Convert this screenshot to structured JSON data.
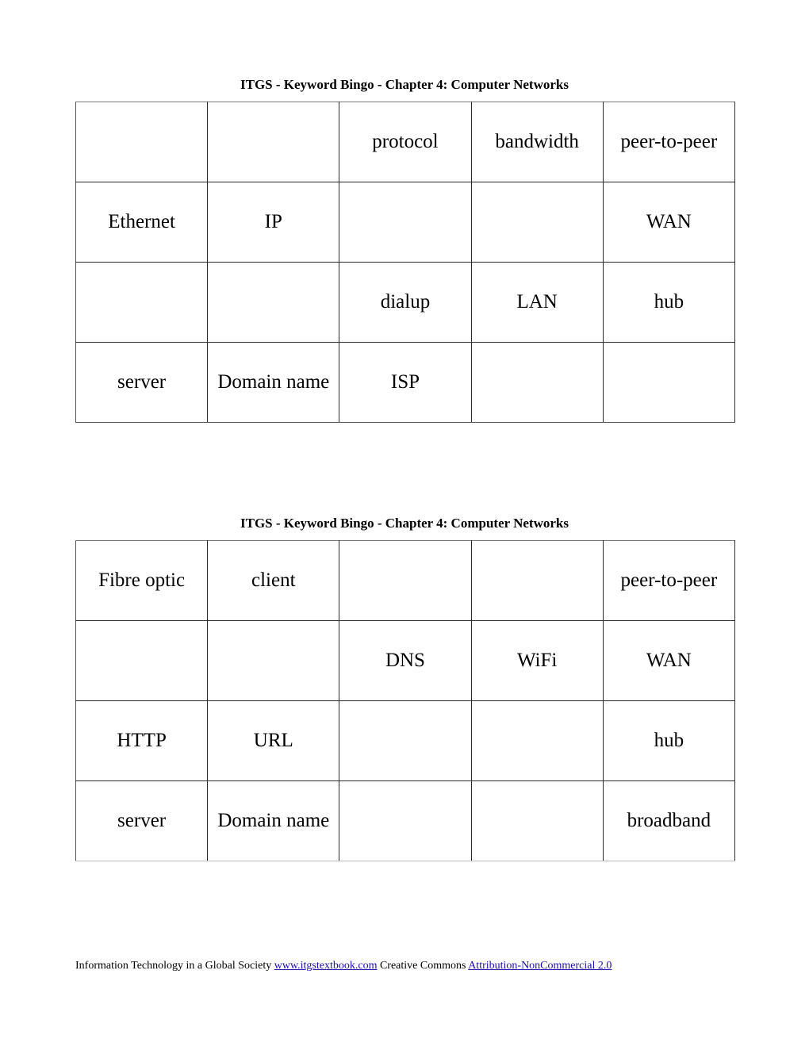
{
  "sheets": [
    {
      "title": "ITGS - Keyword Bingo - Chapter 4: Computer Networks",
      "grid": [
        [
          "",
          "",
          "protocol",
          "bandwidth",
          "peer-to-peer"
        ],
        [
          "Ethernet",
          "IP",
          "",
          "",
          "WAN"
        ],
        [
          "",
          "",
          "dialup",
          "LAN",
          "hub"
        ],
        [
          "server",
          "Domain name",
          "ISP",
          "",
          ""
        ]
      ]
    },
    {
      "title": "ITGS - Keyword Bingo - Chapter 4: Computer Networks",
      "grid": [
        [
          "Fibre optic",
          "client",
          "",
          "",
          "peer-to-peer"
        ],
        [
          "",
          "",
          "DNS",
          "WiFi",
          "WAN"
        ],
        [
          "HTTP",
          "URL",
          "",
          "",
          "hub"
        ],
        [
          "server",
          "Domain name",
          "",
          "",
          "broadband"
        ]
      ]
    }
  ],
  "footer": {
    "text1": "Information Technology in a Global Society ",
    "link1": "www.itgstextbook.com",
    "text2": " Creative Commons ",
    "link2": "Attribution-NonCommercial 2.0"
  },
  "colors": {
    "link": "#1a0dab",
    "text": "#000000",
    "border": "#2b2b2b"
  }
}
